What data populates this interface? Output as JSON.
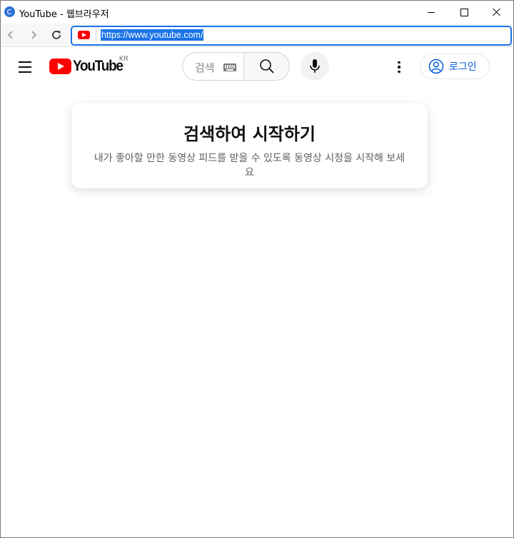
{
  "window": {
    "title": "YouTube - 웹브라우저",
    "controls": [
      "minimize",
      "maximize",
      "close"
    ]
  },
  "navigation": {
    "icons": [
      "back-icon",
      "forward-icon",
      "reload-icon"
    ],
    "address_url": "https://www.youtube.com/",
    "address_selected": true
  },
  "masthead": {
    "country_code": "KR",
    "search_placeholder": "검색",
    "signin_label": "로그인"
  },
  "prompt": {
    "title": "검색하여 시작하기",
    "body": "내가 좋아할 만한 동영상 피드를 받을 수 있도록 동영상 시청을 시작해 보세요"
  },
  "colors": {
    "brand_red": "#ff0000",
    "link_blue": "#065fd4",
    "selection_blue": "#1a73e8"
  }
}
